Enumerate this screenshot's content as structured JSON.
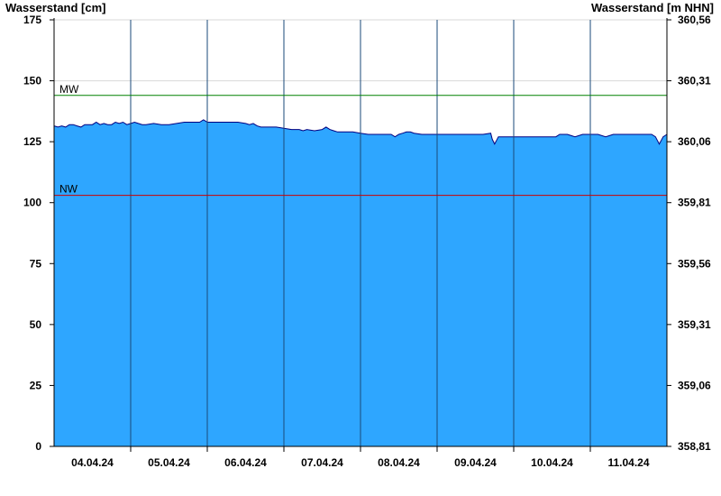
{
  "chart_data": {
    "type": "area",
    "ylabel": "Wasserstand [cm]",
    "ylabel_right": "Wasserstand [m NHN]",
    "xlabel": "",
    "ylim": [
      0,
      175
    ],
    "y_ticks": [
      0,
      25,
      50,
      75,
      100,
      125,
      150,
      175
    ],
    "y_ticks_right": [
      "358,81",
      "359,06",
      "359,31",
      "359,56",
      "359,81",
      "360,06",
      "360,31",
      "360,56"
    ],
    "x_ticks": [
      "04.04.24",
      "05.04.24",
      "06.04.24",
      "07.04.24",
      "08.04.24",
      "09.04.24",
      "10.04.24",
      "11.04.24"
    ],
    "x_range_days": [
      0,
      8
    ],
    "grid": true,
    "reference_lines": [
      {
        "label": "MW",
        "value": 144,
        "color": "#008000"
      },
      {
        "label": "NW",
        "value": 103,
        "color": "#cc0000"
      }
    ],
    "series": [
      {
        "color": "#2ea6ff",
        "x": [
          0,
          0.05,
          0.1,
          0.15,
          0.2,
          0.25,
          0.3,
          0.35,
          0.4,
          0.45,
          0.5,
          0.55,
          0.6,
          0.65,
          0.7,
          0.75,
          0.8,
          0.85,
          0.9,
          0.95,
          1.0,
          1.05,
          1.1,
          1.15,
          1.2,
          1.3,
          1.4,
          1.5,
          1.6,
          1.7,
          1.8,
          1.9,
          1.95,
          2.0,
          2.05,
          2.1,
          2.2,
          2.3,
          2.4,
          2.5,
          2.55,
          2.6,
          2.65,
          2.7,
          2.75,
          2.8,
          2.9,
          3.0,
          3.1,
          3.2,
          3.25,
          3.3,
          3.4,
          3.5,
          3.55,
          3.6,
          3.65,
          3.7,
          3.8,
          3.9,
          4.0,
          4.1,
          4.2,
          4.3,
          4.4,
          4.45,
          4.5,
          4.55,
          4.6,
          4.65,
          4.7,
          4.8,
          4.9,
          5.0,
          5.1,
          5.2,
          5.3,
          5.4,
          5.5,
          5.6,
          5.7,
          5.72,
          5.75,
          5.8,
          5.9,
          6.0,
          6.1,
          6.2,
          6.3,
          6.4,
          6.5,
          6.55,
          6.6,
          6.7,
          6.8,
          6.9,
          7.0,
          7.1,
          7.2,
          7.3,
          7.4,
          7.5,
          7.6,
          7.7,
          7.8,
          7.85,
          7.9,
          7.95,
          8.0
        ],
        "values": [
          131.5,
          131,
          131.5,
          131,
          132,
          132,
          131.5,
          131,
          132,
          132,
          132,
          133,
          132,
          132.5,
          132,
          132,
          133,
          132.5,
          133,
          132,
          132.5,
          133,
          132.5,
          132,
          132,
          132.5,
          132,
          132,
          132.5,
          133,
          133,
          133,
          134,
          133,
          133,
          133,
          133,
          133,
          133,
          132.5,
          132,
          132.5,
          131.5,
          131,
          131,
          131,
          131,
          130.5,
          130,
          130,
          129.5,
          130,
          129.5,
          130,
          131,
          130,
          129.5,
          129,
          129,
          129,
          128.5,
          128,
          128,
          128,
          128,
          127,
          128,
          128.5,
          129,
          129,
          128.5,
          128,
          128,
          128,
          128,
          128,
          128,
          128,
          128,
          128,
          128.5,
          126,
          124,
          127,
          127,
          127,
          127,
          127,
          127,
          127,
          127,
          127,
          128,
          128,
          127,
          128,
          128,
          128,
          127,
          128,
          128,
          128,
          128,
          128,
          128,
          127,
          124,
          127,
          128
        ]
      }
    ]
  }
}
